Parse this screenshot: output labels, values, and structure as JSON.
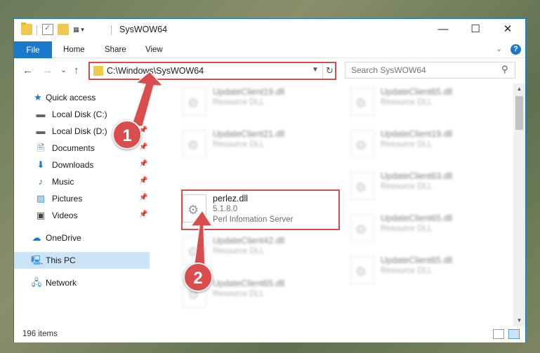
{
  "window": {
    "title": "SysWOW64",
    "controls": {
      "minimize": "—",
      "maximize": "☐",
      "close": "✕"
    }
  },
  "ribbon": {
    "tabs": [
      "File",
      "Home",
      "Share",
      "View"
    ]
  },
  "nav": {
    "back": "←",
    "forward": "→",
    "recent": "⌄",
    "up": "↑",
    "address": "C:\\Windows\\SysWOW64",
    "search_placeholder": "Search SysWOW64"
  },
  "sidebar": {
    "items": [
      {
        "label": "Quick access",
        "icon": "star-icon"
      },
      {
        "label": "Local Disk (C:)",
        "icon": "drive-icon",
        "pinned": true
      },
      {
        "label": "Local Disk (D:)",
        "icon": "drive-icon",
        "pinned": true
      },
      {
        "label": "Documents",
        "icon": "document-icon",
        "pinned": true
      },
      {
        "label": "Downloads",
        "icon": "download-icon",
        "pinned": true
      },
      {
        "label": "Music",
        "icon": "music-icon",
        "pinned": true
      },
      {
        "label": "Pictures",
        "icon": "picture-icon",
        "pinned": true
      },
      {
        "label": "Videos",
        "icon": "video-icon",
        "pinned": true
      },
      {
        "label": "OneDrive",
        "icon": "cloud-icon"
      },
      {
        "label": "This PC",
        "icon": "computer-icon",
        "selected": true
      },
      {
        "label": "Network",
        "icon": "network-icon"
      }
    ]
  },
  "files": {
    "left": [
      {
        "name": "UpdateClient19.dll",
        "desc": "Resource DLL"
      },
      {
        "name": "UpdateClient21.dll",
        "desc": "Resource DLL"
      },
      {
        "name": "perlez.dll",
        "version": "5.1.8.0",
        "desc": "Perl Infomation Server"
      },
      {
        "name": "UpdateClient42.dll",
        "desc": "Resource DLL"
      },
      {
        "name": "UpdateClient65.dll",
        "desc": "Resource DLL"
      }
    ],
    "right": [
      {
        "name": "UpdateClient65.dll",
        "desc": "Resource DLL"
      },
      {
        "name": "UpdateClient19.dll",
        "desc": "Resource DLL"
      },
      {
        "name": "UpdateClient63.dll",
        "desc": "Resource DLL"
      },
      {
        "name": "UpdateClient65.dll",
        "desc": "Resource DLL"
      },
      {
        "name": "UpdateClient65.dll",
        "desc": "Resource DLL"
      }
    ]
  },
  "status": {
    "item_count": "196 items"
  },
  "annotations": {
    "step1": "1",
    "step2": "2"
  },
  "colors": {
    "accent": "#1979ca",
    "highlight": "#d94d4d",
    "selected": "#cce4f7"
  }
}
